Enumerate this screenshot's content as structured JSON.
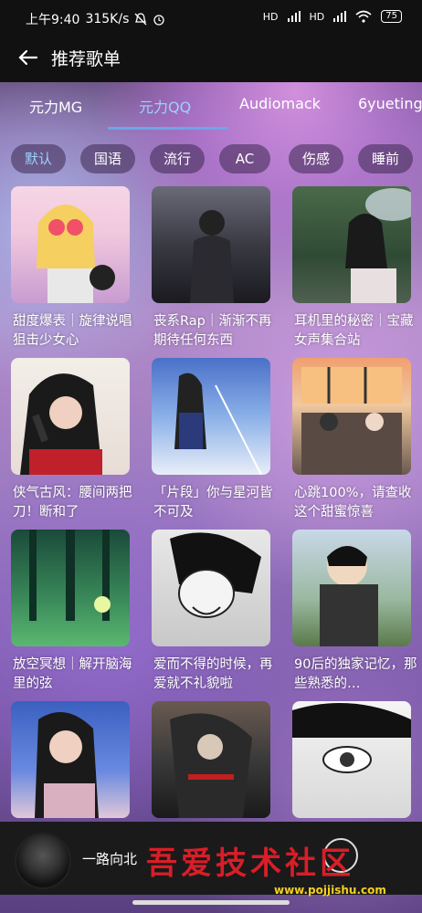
{
  "status_bar": {
    "time": "上午9:40",
    "speed": "315K/s",
    "signal1": "HD",
    "signal2": "HD",
    "battery": "75"
  },
  "header": {
    "title": "推荐歌单"
  },
  "tabs": [
    {
      "label": "元力MG"
    },
    {
      "label": "元力QQ"
    },
    {
      "label": "Audiomack"
    },
    {
      "label": "6yueting"
    }
  ],
  "chips": [
    {
      "label": "默认"
    },
    {
      "label": "国语"
    },
    {
      "label": "流行"
    },
    {
      "label": "AC"
    },
    {
      "label": "伤感"
    },
    {
      "label": "睡前"
    }
  ],
  "playlists": [
    {
      "title": "甜度爆表｜旋律说唱狙击少女心"
    },
    {
      "title": "丧系Rap｜渐渐不再期待任何东西"
    },
    {
      "title": "耳机里的秘密｜宝藏女声集合站"
    },
    {
      "title": "侠气古风：腰间两把刀！断和了"
    },
    {
      "title": "「片段」你与星河皆不可及"
    },
    {
      "title": "心跳100%，请查收这个甜蜜惊喜"
    },
    {
      "title": "放空冥想｜解开脑海里的弦"
    },
    {
      "title": "爱而不得的时候，再爱就不礼貌啦"
    },
    {
      "title": "90后的独家记忆，那些熟悉的…"
    },
    {
      "title": ""
    },
    {
      "title": ""
    },
    {
      "title": ""
    }
  ],
  "player": {
    "song": "一路向北"
  },
  "watermark": {
    "text": "吾爱技术社区",
    "url": "www.pojjishu.com"
  },
  "colors": {
    "accent": "#9fd0ff",
    "indicator": "#6aa8e8",
    "watermark": "#d81e28"
  }
}
